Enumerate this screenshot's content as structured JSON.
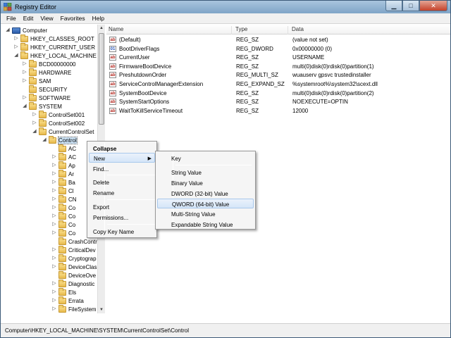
{
  "window": {
    "title": "Registry Editor"
  },
  "menubar": [
    "File",
    "Edit",
    "View",
    "Favorites",
    "Help"
  ],
  "tree": [
    {
      "label": "Computer",
      "depth": 0,
      "expander": "-",
      "icon": "computer-icon"
    },
    {
      "label": "HKEY_CLASSES_ROOT",
      "depth": 1,
      "expander": "+"
    },
    {
      "label": "HKEY_CURRENT_USER",
      "depth": 1,
      "expander": "+"
    },
    {
      "label": "HKEY_LOCAL_MACHINE",
      "depth": 1,
      "expander": "-"
    },
    {
      "label": "BCD00000000",
      "depth": 2,
      "expander": "+"
    },
    {
      "label": "HARDWARE",
      "depth": 2,
      "expander": "+"
    },
    {
      "label": "SAM",
      "depth": 2,
      "expander": "+"
    },
    {
      "label": "SECURITY",
      "depth": 2,
      "expander": ""
    },
    {
      "label": "SOFTWARE",
      "depth": 2,
      "expander": "+"
    },
    {
      "label": "SYSTEM",
      "depth": 2,
      "expander": "-"
    },
    {
      "label": "ControlSet001",
      "depth": 3,
      "expander": "+"
    },
    {
      "label": "ControlSet002",
      "depth": 3,
      "expander": "+"
    },
    {
      "label": "CurrentControlSet",
      "depth": 3,
      "expander": "-"
    },
    {
      "label": "Control",
      "depth": 4,
      "expander": "-",
      "selected": true
    },
    {
      "label": "AC",
      "depth": 5,
      "expander": ""
    },
    {
      "label": "AC",
      "depth": 5,
      "expander": "+"
    },
    {
      "label": "Ap",
      "depth": 5,
      "expander": "+"
    },
    {
      "label": "Ar",
      "depth": 5,
      "expander": "+"
    },
    {
      "label": "Ba",
      "depth": 5,
      "expander": "+"
    },
    {
      "label": "Cl",
      "depth": 5,
      "expander": "+"
    },
    {
      "label": "CN",
      "depth": 5,
      "expander": "+"
    },
    {
      "label": "Co",
      "depth": 5,
      "expander": "+"
    },
    {
      "label": "Co",
      "depth": 5,
      "expander": "+"
    },
    {
      "label": "Co",
      "depth": 5,
      "expander": "+"
    },
    {
      "label": "Co",
      "depth": 5,
      "expander": "+"
    },
    {
      "label": "CrashContr",
      "depth": 5,
      "expander": ""
    },
    {
      "label": "CriticalDev",
      "depth": 5,
      "expander": "+"
    },
    {
      "label": "Cryptograp",
      "depth": 5,
      "expander": "+"
    },
    {
      "label": "DeviceClas",
      "depth": 5,
      "expander": "+"
    },
    {
      "label": "DeviceOve",
      "depth": 5,
      "expander": ""
    },
    {
      "label": "Diagnostic",
      "depth": 5,
      "expander": "+"
    },
    {
      "label": "Els",
      "depth": 5,
      "expander": "+"
    },
    {
      "label": "Errata",
      "depth": 5,
      "expander": "+"
    },
    {
      "label": "FileSystem",
      "depth": 5,
      "expander": "+"
    }
  ],
  "list": {
    "headers": {
      "name": "Name",
      "type": "Type",
      "data": "Data"
    },
    "rows": [
      {
        "name": "(Default)",
        "type": "REG_SZ",
        "data": "(value not set)",
        "icon": "ab"
      },
      {
        "name": "BootDriverFlags",
        "type": "REG_DWORD",
        "data": "0x00000000 (0)",
        "icon": "bin"
      },
      {
        "name": "CurrentUser",
        "type": "REG_SZ",
        "data": "USERNAME",
        "icon": "ab"
      },
      {
        "name": "FirmwareBootDevice",
        "type": "REG_SZ",
        "data": "multi(0)disk(0)rdisk(0)partition(1)",
        "icon": "ab"
      },
      {
        "name": "PreshutdownOrder",
        "type": "REG_MULTI_SZ",
        "data": "wuauserv gpsvc trustedinstaller",
        "icon": "ab"
      },
      {
        "name": "ServiceControlManagerExtension",
        "type": "REG_EXPAND_SZ",
        "data": "%systemroot%\\system32\\scext.dll",
        "icon": "ab"
      },
      {
        "name": "SystemBootDevice",
        "type": "REG_SZ",
        "data": "multi(0)disk(0)rdisk(0)partition(2)",
        "icon": "ab"
      },
      {
        "name": "SystemStartOptions",
        "type": "REG_SZ",
        "data": " NOEXECUTE=OPTIN",
        "icon": "ab"
      },
      {
        "name": "WaitToKillServiceTimeout",
        "type": "REG_SZ",
        "data": "12000",
        "icon": "ab"
      }
    ]
  },
  "context_menu": {
    "items": [
      {
        "label": "Collapse",
        "bold": true
      },
      {
        "label": "New",
        "submenu": true,
        "highlighted": true
      },
      {
        "label": "Find..."
      },
      {
        "label": "Delete"
      },
      {
        "label": "Rename"
      },
      {
        "label": "Export"
      },
      {
        "label": "Permissions..."
      },
      {
        "label": "Copy Key Name"
      }
    ]
  },
  "new_submenu": {
    "items": [
      {
        "label": "Key"
      },
      {
        "label": "String Value"
      },
      {
        "label": "Binary Value"
      },
      {
        "label": "DWORD (32-bit) Value"
      },
      {
        "label": "QWORD (64-bit) Value",
        "highlighted": true
      },
      {
        "label": "Multi-String Value"
      },
      {
        "label": "Expandable String Value"
      }
    ]
  },
  "statusbar": {
    "path": "Computer\\HKEY_LOCAL_MACHINE\\SYSTEM\\CurrentControlSet\\Control"
  },
  "colors": {
    "titlebar": "#8fb0cf",
    "highlight": "#d5e6f8",
    "selection": "#cde4f7"
  }
}
